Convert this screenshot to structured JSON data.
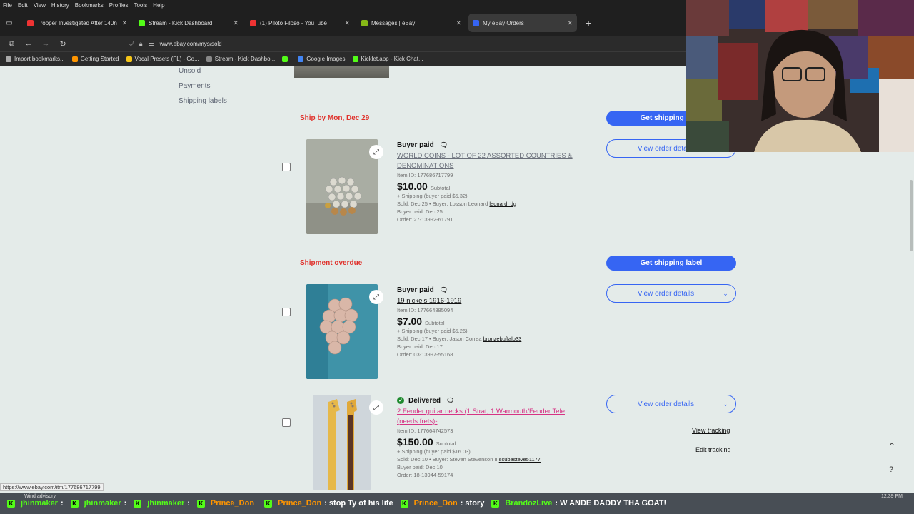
{
  "menu": [
    "File",
    "Edit",
    "View",
    "History",
    "Bookmarks",
    "Profiles",
    "Tools",
    "Help"
  ],
  "tabs": [
    {
      "title": "Trooper Investigated After 140n",
      "color": "#e33",
      "active": false
    },
    {
      "title": "Stream - Kick Dashboard",
      "color": "#53fc18",
      "active": false
    },
    {
      "title": "(1) Piloto Filoso - YouTube",
      "color": "#e33",
      "active": false
    },
    {
      "title": "Messages | eBay",
      "color": "#86b817",
      "active": false
    },
    {
      "title": "My eBay Orders",
      "color": "#3665f3",
      "active": true
    }
  ],
  "url": "www.ebay.com/mys/sold",
  "bookmarks": [
    {
      "label": "Import bookmarks...",
      "color": "#aaa"
    },
    {
      "label": "Getting Started",
      "color": "#ff9500"
    },
    {
      "label": "Vocal Presets (FL) - Go...",
      "color": "#f5c518"
    },
    {
      "label": "Stream - Kick Dashbo...",
      "color": "#888"
    },
    {
      "label": "",
      "color": "#53fc18"
    },
    {
      "label": "Google Images",
      "color": "#4285f4"
    },
    {
      "label": "Kicklet.app - Kick Chat...",
      "color": "#53fc18"
    }
  ],
  "sidenav": [
    "Unsold",
    "Payments",
    "Shipping labels"
  ],
  "groups": [
    {
      "heading": "Ship by Mon, Dec 29",
      "action": "Get shipping label",
      "order": {
        "status": "Buyer paid",
        "title": "WORLD COINS - LOT OF 22 ASSORTED COUNTRIES & DENOMINATIONS",
        "item_id": "Item ID: 177686717799",
        "price": "$10.00",
        "subtotal": "Subtotal",
        "shipping": "+ Shipping (buyer paid $5.32)",
        "sold": "Sold: Dec 25 • Buyer: Losson Leonard",
        "buyer_user": "leonard_dg",
        "paid": "Buyer paid: Dec 25",
        "order_no": "Order: 27-13992-61791",
        "details": "View order details"
      }
    },
    {
      "heading": "Shipment overdue",
      "action": "Get shipping label",
      "order": {
        "status": "Buyer paid",
        "title": "19 nickels 1916-1919",
        "item_id": "Item ID: 177664885094",
        "price": "$7.00",
        "subtotal": "Subtotal",
        "shipping": "+ Shipping (buyer paid $5.26)",
        "sold": "Sold: Dec 17 • Buyer: Jason Correa",
        "buyer_user": "bronzebuffalo33",
        "paid": "Buyer paid: Dec 17",
        "order_no": "Order: 03-13997-55168",
        "details": "View order details"
      }
    },
    {
      "heading": "",
      "action": "",
      "order": {
        "status": "Delivered",
        "title": "2 Fender guitar necks (1 Strat, 1 Warmouth/Fender Tele (needs frets)-",
        "item_id": "Item ID: 177664742573",
        "price": "$150.00",
        "subtotal": "Subtotal",
        "shipping": "+ Shipping (buyer paid $16.03)",
        "sold": "Sold: Dec 10 • Buyer: Steven Stevenson II",
        "buyer_user": "scubasteve51177",
        "paid": "Buyer paid: Dec 10",
        "order_no": "Order: 18-13944-59174",
        "details": "View order details",
        "view_tracking": "View tracking",
        "edit_tracking": "Edit tracking"
      }
    }
  ],
  "status_url": "https://www.ebay.com/itm/177686717799",
  "chat": {
    "weather": "Wind advisory",
    "clock": "12:39 PM",
    "messages": [
      {
        "user": "jhinmaker",
        "text": ":",
        "color": "#53fc18"
      },
      {
        "user": "jhinmaker",
        "text": ":",
        "color": "#53fc18"
      },
      {
        "user": "jhinmaker",
        "text": ":",
        "color": "#53fc18"
      },
      {
        "user": "Prince_Don",
        "text": "",
        "color": "#ff9500"
      },
      {
        "user": "Prince_Don",
        "text": ": stop Ty of his life",
        "color": "#ff9500"
      },
      {
        "user": "Prince_Don",
        "text": ": story",
        "color": "#ff9500"
      },
      {
        "user": "BrandozLive",
        "text": ": W ANDE DADDY THA GOAT!",
        "color": "#53fc18"
      }
    ]
  }
}
